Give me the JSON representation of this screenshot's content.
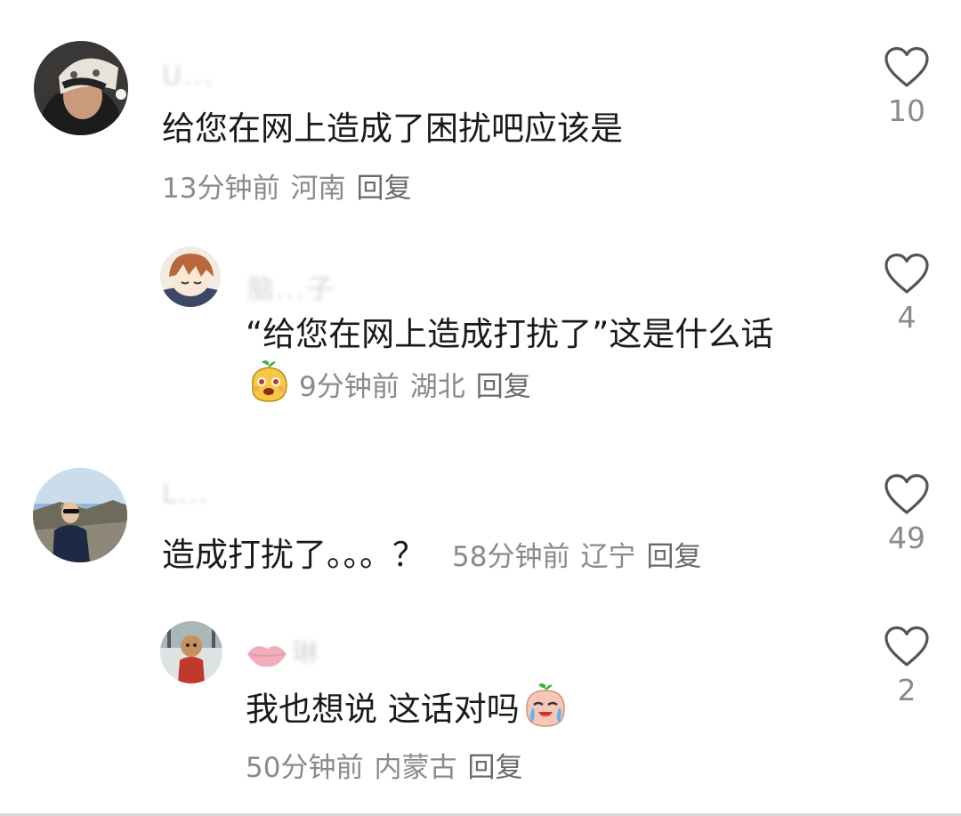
{
  "comments": [
    {
      "username": "U...",
      "text": "给您在网上造成了困扰吧应该是",
      "time": "13分钟前",
      "location": "河南",
      "reply_label": "回复",
      "likes": "10"
    },
    {
      "username": "脑...子",
      "text": "“给您在网上造成打扰了”这是什么话",
      "time": "9分钟前",
      "location": "湖北",
      "reply_label": "回复",
      "likes": "4"
    },
    {
      "username": "L...",
      "text": "造成打扰了。。。？",
      "time": "58分钟前",
      "location": "辽宁",
      "reply_label": "回复",
      "likes": "49"
    },
    {
      "username": "琳",
      "text": "我也想说 这话对吗",
      "time": "50分钟前",
      "location": "内蒙古",
      "reply_label": "回复",
      "likes": "2"
    }
  ],
  "icons": {
    "like": "heart-outline-icon",
    "sticker_mango": "mango-sticker-icon",
    "emoji_crying": "crying-emoji-icon",
    "lips": "lips-icon"
  },
  "colors": {
    "text_primary": "#1a1a1a",
    "text_secondary": "#8a8a8a",
    "heart_outline": "#555555"
  }
}
